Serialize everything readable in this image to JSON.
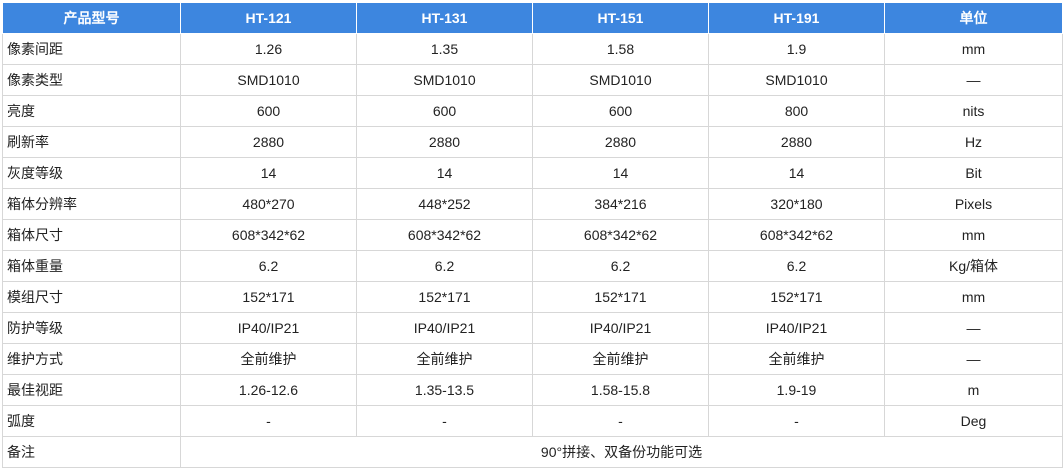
{
  "colors": {
    "header_bg": "#3d86df",
    "header_text": "#ffffff",
    "border": "#d7d7d7"
  },
  "header": {
    "label": "产品型号",
    "models": [
      "HT-121",
      "HT-131",
      "HT-151",
      "HT-191"
    ],
    "unit": "单位"
  },
  "rows": [
    {
      "label": "像素间距",
      "values": [
        "1.26",
        "1.35",
        "1.58",
        "1.9"
      ],
      "unit": "mm"
    },
    {
      "label": "像素类型",
      "values": [
        "SMD1010",
        "SMD1010",
        "SMD1010",
        "SMD1010"
      ],
      "unit": "—"
    },
    {
      "label": "亮度",
      "values": [
        "600",
        "600",
        "600",
        "800"
      ],
      "unit": "nits"
    },
    {
      "label": "刷新率",
      "values": [
        "2880",
        "2880",
        "2880",
        "2880"
      ],
      "unit": "Hz"
    },
    {
      "label": "灰度等级",
      "values": [
        "14",
        "14",
        "14",
        "14"
      ],
      "unit": "Bit"
    },
    {
      "label": "箱体分辨率",
      "values": [
        "480*270",
        "448*252",
        "384*216",
        "320*180"
      ],
      "unit": "Pixels"
    },
    {
      "label": "箱体尺寸",
      "values": [
        "608*342*62",
        "608*342*62",
        "608*342*62",
        "608*342*62"
      ],
      "unit": "mm"
    },
    {
      "label": "箱体重量",
      "values": [
        "6.2",
        "6.2",
        "6.2",
        "6.2"
      ],
      "unit": "Kg/箱体"
    },
    {
      "label": "模组尺寸",
      "values": [
        "152*171",
        "152*171",
        "152*171",
        "152*171"
      ],
      "unit": "mm"
    },
    {
      "label": "防护等级",
      "values": [
        "IP40/IP21",
        "IP40/IP21",
        "IP40/IP21",
        "IP40/IP21"
      ],
      "unit": "—"
    },
    {
      "label": "维护方式",
      "values": [
        "全前维护",
        "全前维护",
        "全前维护",
        "全前维护"
      ],
      "unit": "—"
    },
    {
      "label": "最佳视距",
      "values": [
        "1.26-12.6",
        "1.35-13.5",
        "1.58-15.8",
        "1.9-19"
      ],
      "unit": "m"
    },
    {
      "label": "弧度",
      "values": [
        "-",
        "-",
        "-",
        "-"
      ],
      "unit": "Deg"
    }
  ],
  "note": {
    "label": "备注",
    "value": "90°拼接、双备份功能可选"
  }
}
